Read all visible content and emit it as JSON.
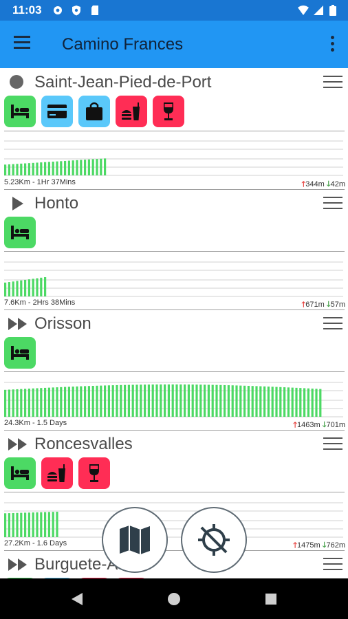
{
  "status_bar": {
    "time": "11:03",
    "left_icons": [
      "settings-gear-icon",
      "shield-icon",
      "sd-card-icon"
    ],
    "right_icons": [
      "wifi-icon",
      "cell-signal-icon",
      "battery-icon"
    ]
  },
  "app_bar": {
    "title": "Camino Frances",
    "menu_icon": "hamburger-menu-icon",
    "overflow_icon": "more-vert-icon"
  },
  "colors": {
    "status_bar": "#1976d2",
    "app_bar": "#2196f3",
    "amenity_green": "#4cd964",
    "amenity_blue": "#5ac8fa",
    "amenity_red": "#ff2d55",
    "elevation_bars": "#4cd964",
    "ascent_arrow": "#e53935",
    "descent_arrow": "#43a047"
  },
  "stages": [
    {
      "name": "Saint-Jean-Pied-de-Port",
      "marker": "circle-icon",
      "amenities": [
        "bed-icon",
        "credit-card-icon",
        "shopping-bag-icon",
        "food-drink-icon",
        "wine-glass-icon"
      ],
      "distance_time": "5.23Km - 1Hr 37Mins",
      "ascent": "344m",
      "descent": "42m",
      "profile_fraction": 0.3
    },
    {
      "name": "Honto",
      "marker": "play-icon",
      "amenities": [
        "bed-icon"
      ],
      "distance_time": "7.6Km - 2Hrs 38Mins",
      "ascent": "671m",
      "descent": "57m",
      "profile_fraction": 0.13
    },
    {
      "name": "Orisson",
      "marker": "fast-forward-icon",
      "amenities": [
        "bed-icon"
      ],
      "distance_time": "24.3Km - 1.5 Days",
      "ascent": "1463m",
      "descent": "701m",
      "profile_fraction": 0.94
    },
    {
      "name": "Roncesvalles",
      "marker": "fast-forward-icon",
      "amenities": [
        "bed-icon",
        "food-drink-icon",
        "wine-glass-icon"
      ],
      "distance_time": "27.2Km - 1.6 Days",
      "ascent": "1475m",
      "descent": "762m",
      "profile_fraction": 0.17
    },
    {
      "name": "Burguete-A",
      "marker": "fast-forward-icon",
      "amenities": [
        "bed-icon",
        "credit-card-icon",
        "food-drink-icon",
        "wine-glass-icon"
      ]
    }
  ],
  "fabs": {
    "map": "map-icon",
    "location": "location-disabled-icon"
  },
  "nav_bar": [
    "back-icon",
    "home-icon",
    "recents-icon"
  ]
}
